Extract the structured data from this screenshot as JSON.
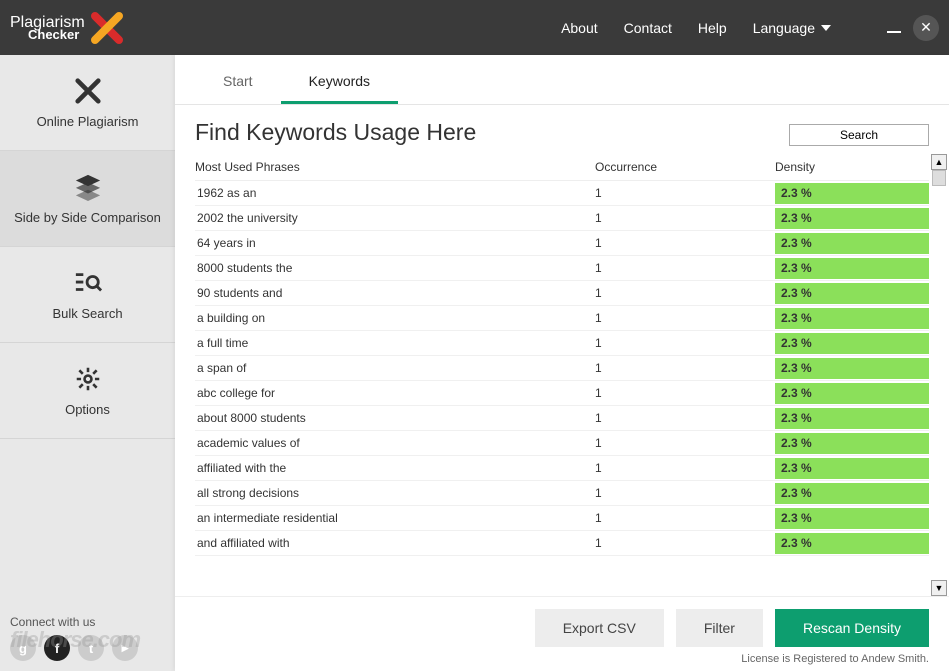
{
  "titlebar": {
    "logo_line1": "Plagiarism",
    "logo_line2": "Checker",
    "menu": {
      "about": "About",
      "contact": "Contact",
      "help": "Help",
      "language": "Language"
    }
  },
  "sidebar": {
    "items": [
      {
        "label": "Online Plagiarism"
      },
      {
        "label": "Side by Side Comparison"
      },
      {
        "label": "Bulk Search"
      },
      {
        "label": "Options"
      }
    ],
    "connect": "Connect with us"
  },
  "tabs": {
    "start": "Start",
    "keywords": "Keywords"
  },
  "heading": "Find Keywords Usage Here",
  "search_button": "Search",
  "columns": {
    "phrase": "Most Used Phrases",
    "occurrence": "Occurrence",
    "density": "Density"
  },
  "rows": [
    {
      "phrase": "1962 as an",
      "occurrence": "1",
      "density": "2.3 %"
    },
    {
      "phrase": "2002 the university",
      "occurrence": "1",
      "density": "2.3 %"
    },
    {
      "phrase": "64 years in",
      "occurrence": "1",
      "density": "2.3 %"
    },
    {
      "phrase": "8000 students the",
      "occurrence": "1",
      "density": "2.3 %"
    },
    {
      "phrase": "90 students and",
      "occurrence": "1",
      "density": "2.3 %"
    },
    {
      "phrase": "a building on",
      "occurrence": "1",
      "density": "2.3 %"
    },
    {
      "phrase": "a full time",
      "occurrence": "1",
      "density": "2.3 %"
    },
    {
      "phrase": "a span of",
      "occurrence": "1",
      "density": "2.3 %"
    },
    {
      "phrase": "abc college for",
      "occurrence": "1",
      "density": "2.3 %"
    },
    {
      "phrase": "about 8000 students",
      "occurrence": "1",
      "density": "2.3 %"
    },
    {
      "phrase": "academic values of",
      "occurrence": "1",
      "density": "2.3 %"
    },
    {
      "phrase": "affiliated with the",
      "occurrence": "1",
      "density": "2.3 %"
    },
    {
      "phrase": "all strong decisions",
      "occurrence": "1",
      "density": "2.3 %"
    },
    {
      "phrase": "an intermediate residential",
      "occurrence": "1",
      "density": "2.3 %"
    },
    {
      "phrase": "and affiliated with",
      "occurrence": "1",
      "density": "2.3 %"
    }
  ],
  "footer": {
    "export": "Export CSV",
    "filter": "Filter",
    "rescan": "Rescan Density"
  },
  "license": "License is Registered to Andew Smith."
}
